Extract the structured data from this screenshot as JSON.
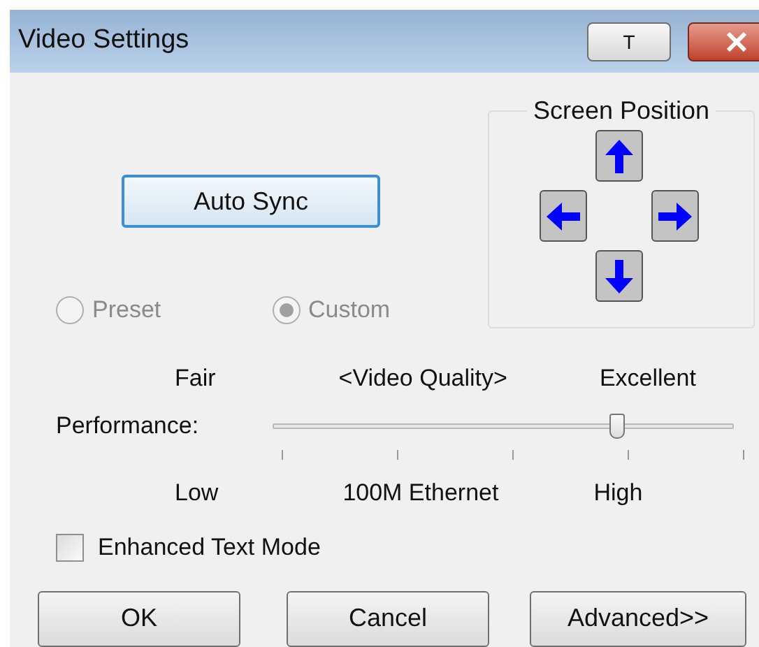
{
  "window": {
    "title": "Video Settings",
    "title_button": "T"
  },
  "auto_sync": "Auto Sync",
  "mode_options": [
    {
      "label": "Preset",
      "selected": false,
      "disabled": true
    },
    {
      "label": "Custom",
      "selected": true,
      "disabled": true
    }
  ],
  "screen_position": {
    "title": "Screen Position"
  },
  "quality": {
    "left": "Fair",
    "center": "<Video Quality>",
    "right": "Excellent"
  },
  "performance": {
    "label": "Performance:",
    "level": 0.75,
    "low": "Low",
    "middle": "100M Ethernet",
    "high": "High"
  },
  "enhanced_text_mode": {
    "label": "Enhanced Text Mode",
    "checked": false
  },
  "buttons": [
    "OK",
    "Cancel",
    "Advanced>>"
  ]
}
